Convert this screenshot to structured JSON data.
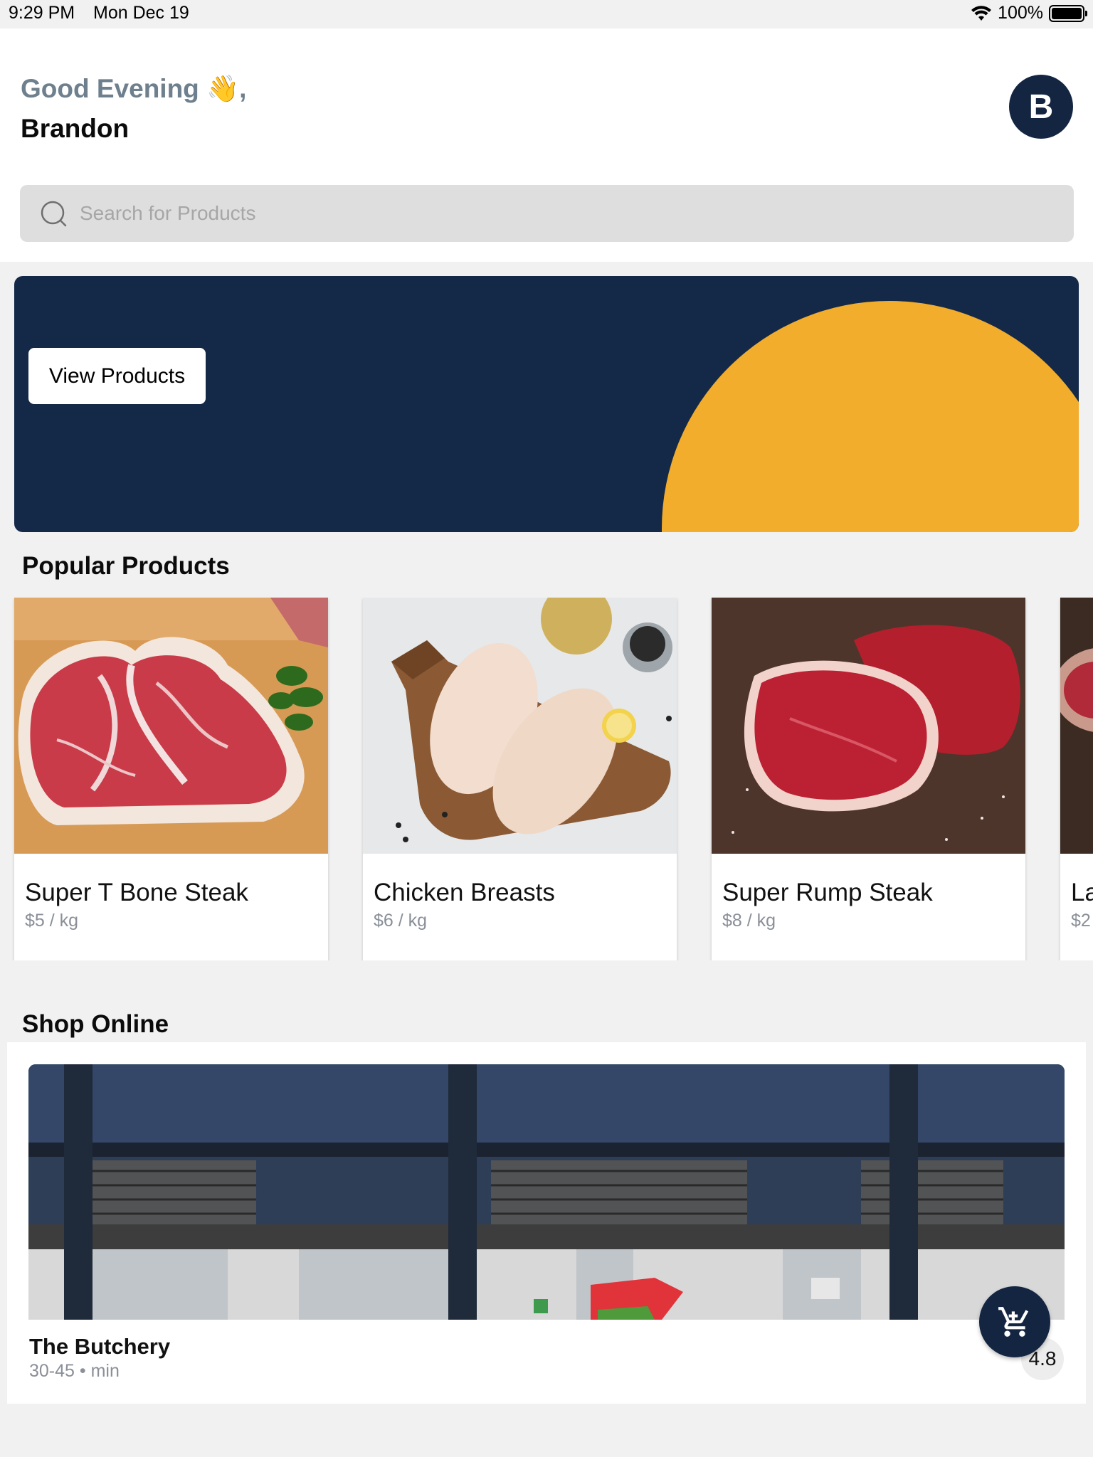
{
  "status_bar": {
    "time": "9:29 PM",
    "date": "Mon Dec 19",
    "battery": "100%",
    "battery_level": 1.0
  },
  "header": {
    "greeting": "Good Evening 👋,",
    "username": "Brandon",
    "avatar_initial": "B"
  },
  "search": {
    "placeholder": "Search for Products"
  },
  "banner": {
    "button_label": "View Products"
  },
  "popular": {
    "title": "Popular Products",
    "products": [
      {
        "name": "Super T Bone Steak",
        "price": "$5 / kg"
      },
      {
        "name": "Chicken Breasts",
        "price": "$6 / kg"
      },
      {
        "name": "Super Rump Steak",
        "price": "$8 / kg"
      },
      {
        "name": "La",
        "price": "$2"
      }
    ]
  },
  "shop_online": {
    "title": "Shop Online",
    "shop_name": "The Butchery",
    "shop_meta": "30-45 • min",
    "rating": "4.8"
  },
  "colors": {
    "navy": "#142542",
    "accent_yellow": "#f2ad2d",
    "muted_text": "#8a8f98"
  },
  "icons": {
    "search": "search-icon",
    "cart": "cart-icon",
    "wifi": "wifi-icon",
    "battery": "battery-icon"
  }
}
